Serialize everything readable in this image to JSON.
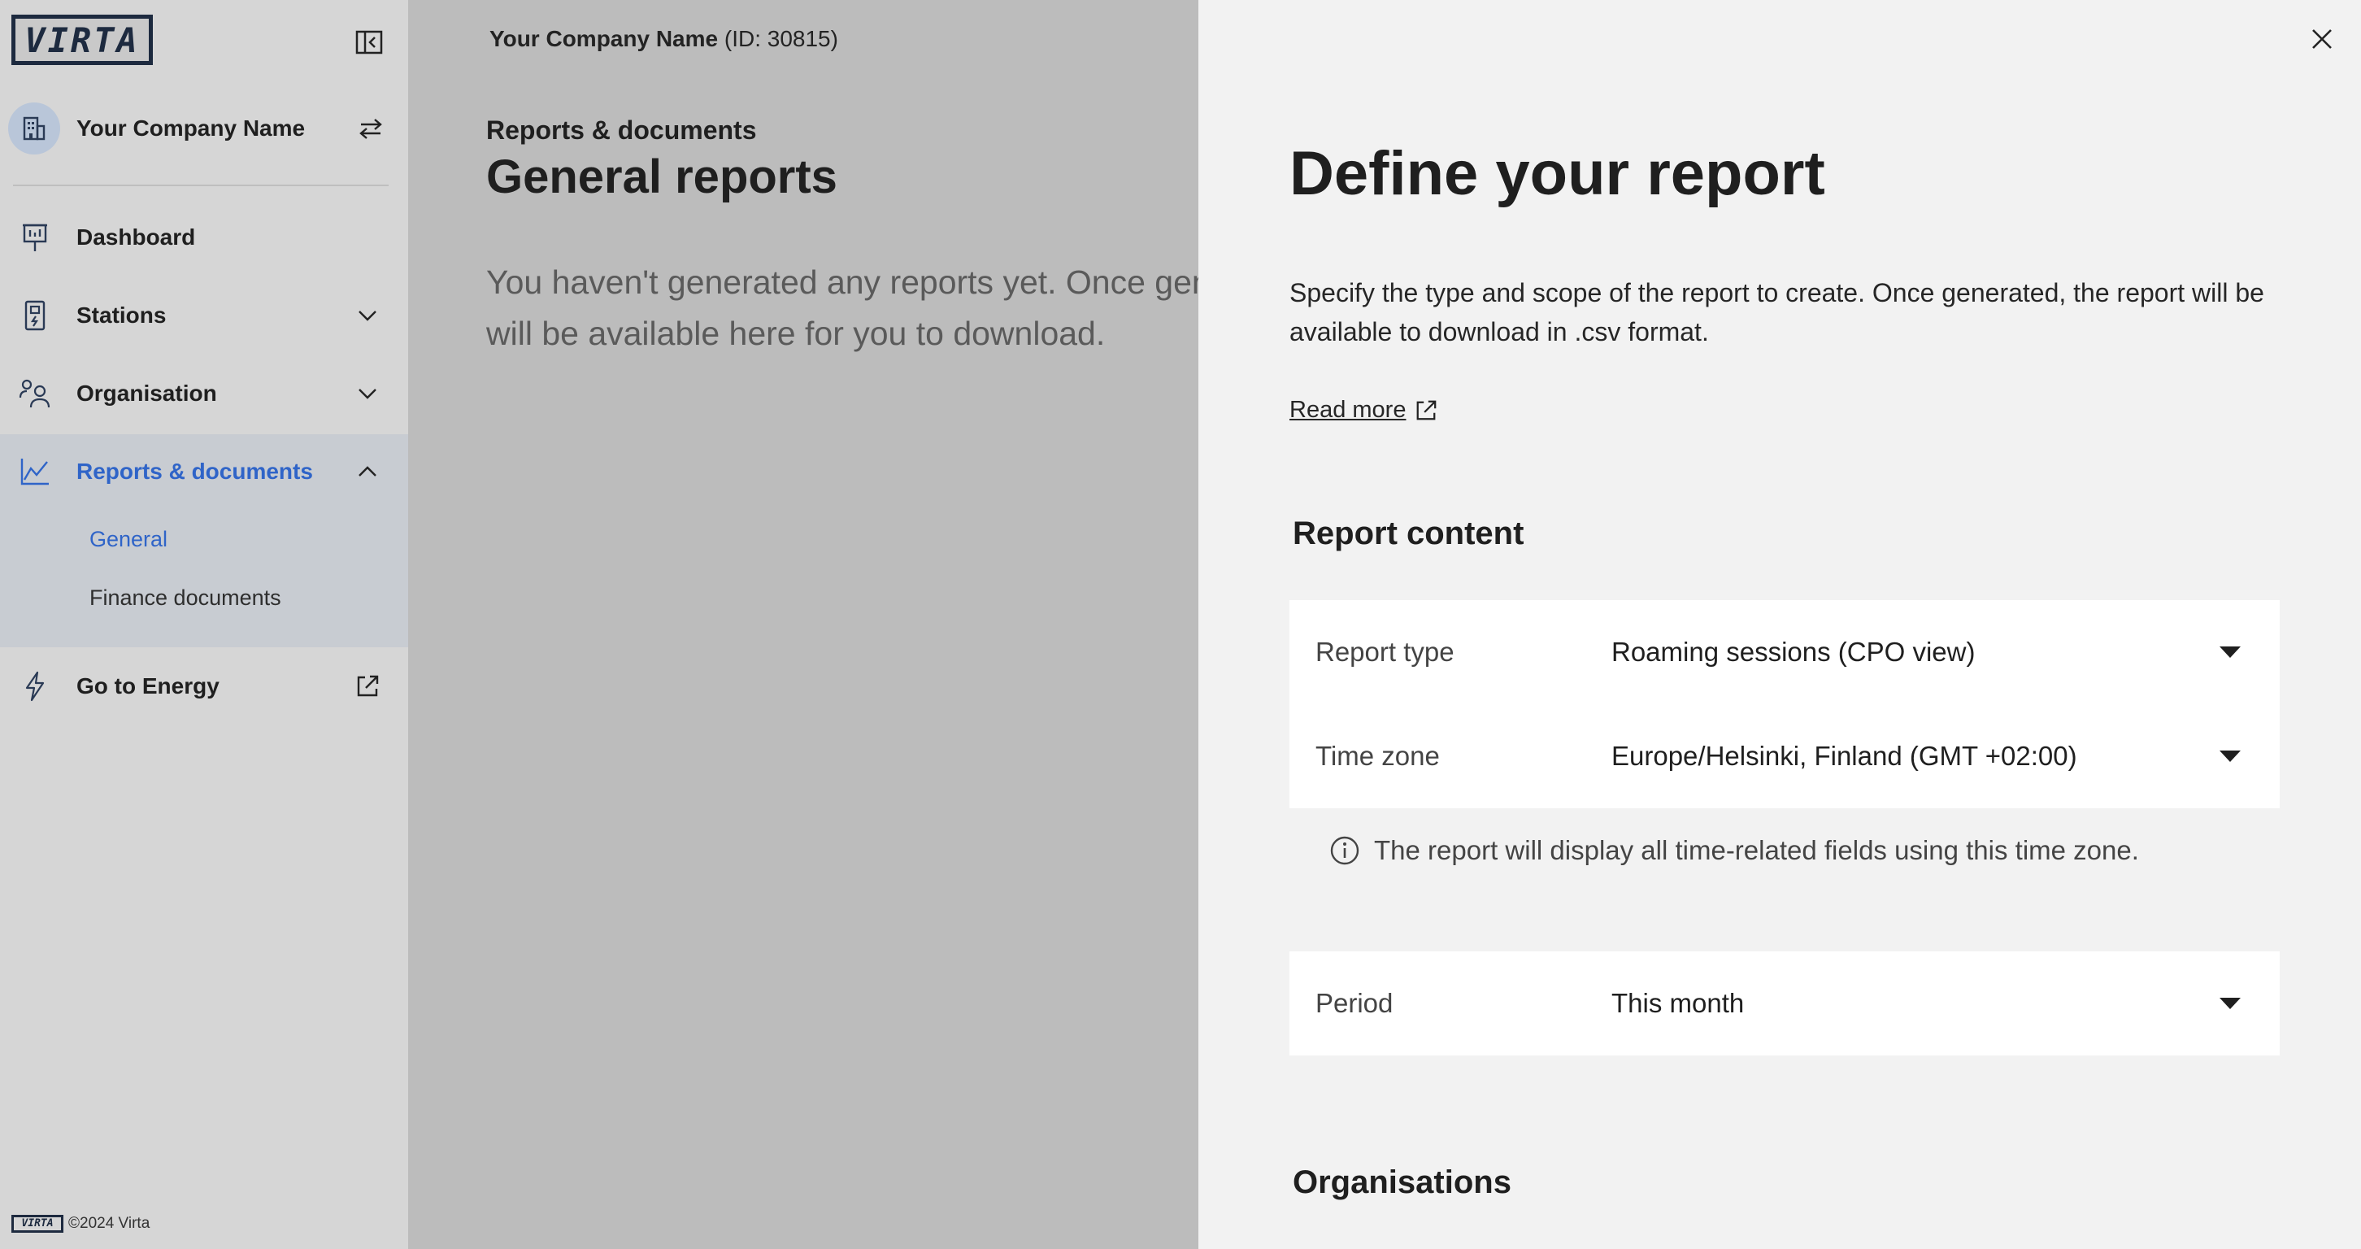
{
  "sidebar": {
    "logo_text": "VIRTA",
    "company_name": "Your Company Name",
    "nav": {
      "dashboard": "Dashboard",
      "stations": "Stations",
      "organisation": "Organisation",
      "reports": "Reports & documents",
      "go_to_energy": "Go to Energy"
    },
    "subnav": {
      "general": "General",
      "finance_documents": "Finance documents"
    },
    "footer": {
      "logo_text": "VIRTA",
      "copyright": "©2024 Virta"
    },
    "icons": [
      "collapse-sidebar-icon",
      "building-icon",
      "switch-arrows-icon",
      "presentation-icon",
      "charging-station-icon",
      "people-icon",
      "chart-icon",
      "lightning-icon",
      "external-link-icon",
      "chevron-down-icon",
      "chevron-up-icon"
    ]
  },
  "main": {
    "org_name": "Your Company Name",
    "org_id": "(ID: 30815)",
    "breadcrumb": "Reports & documents",
    "page_title": "General reports",
    "empty_state": "You haven't generated any reports yet. Once generated, reports will be available here for you to download."
  },
  "drawer": {
    "title": "Define your report",
    "description": "Specify the type and scope of the report to create. Once generated, the report will be available to download in .csv format.",
    "read_more": "Read more",
    "report_content_title": "Report content",
    "fields": {
      "report_type": {
        "label": "Report type",
        "value": "Roaming sessions (CPO view)"
      },
      "time_zone": {
        "label": "Time zone",
        "value": "Europe/Helsinki, Finland (GMT +02:00)"
      },
      "period": {
        "label": "Period",
        "value": "This month"
      }
    },
    "time_zone_info": "The report will display all time-related fields using this time zone.",
    "organisations_title": "Organisations"
  },
  "colors": {
    "accent": "#2f64c8",
    "sidebar_bg": "#d6d6d6",
    "overlay_bg": "#bcbcbc",
    "drawer_bg": "#f2f2f2"
  }
}
